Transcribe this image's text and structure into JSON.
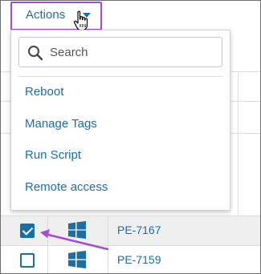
{
  "header": {
    "actions_label": "Actions",
    "caret_icon": "caret-down-icon",
    "cursor_icon": "hand-pointer-icon",
    "highlight_color": "#a64bd6"
  },
  "dropdown": {
    "search_placeholder": "Search",
    "search_value": "",
    "items": [
      {
        "label": "Reboot"
      },
      {
        "label": "Manage Tags"
      },
      {
        "label": "Run Script"
      },
      {
        "label": "Remote access"
      }
    ]
  },
  "table": {
    "rows": [
      {
        "checked": true,
        "os_icon": "windows-icon",
        "host": "PE-7167"
      },
      {
        "checked": false,
        "os_icon": "windows-icon",
        "host": "PE-7159"
      }
    ]
  },
  "annotation": {
    "arrow_color": "#a64bd6"
  },
  "colors": {
    "link": "#1b6fa3",
    "checked_row_bg": "#efefef"
  }
}
